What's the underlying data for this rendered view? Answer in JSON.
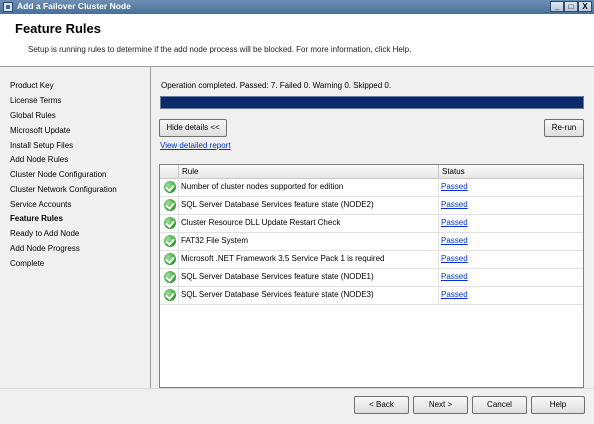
{
  "window": {
    "title": "Add a Failover Cluster Node",
    "buttons": {
      "minimize": "_",
      "maximize": "□",
      "close": "X"
    }
  },
  "header": {
    "title": "Feature Rules",
    "description": "Setup is running rules to determine if the add node process will be blocked. For more information, click Help."
  },
  "nav": {
    "items": [
      {
        "label": "Product Key"
      },
      {
        "label": "License Terms"
      },
      {
        "label": "Global Rules"
      },
      {
        "label": "Microsoft Update"
      },
      {
        "label": "Install Setup Files"
      },
      {
        "label": "Add Node Rules"
      },
      {
        "label": "Cluster Node Configuration"
      },
      {
        "label": "Cluster Network Configuration"
      },
      {
        "label": "Service Accounts"
      },
      {
        "label": "Feature Rules"
      },
      {
        "label": "Ready to Add Node"
      },
      {
        "label": "Add Node Progress"
      },
      {
        "label": "Complete"
      }
    ],
    "active_index": 9
  },
  "content": {
    "summary": "Operation completed. Passed: 7.   Failed 0.   Warning 0.   Skipped 0.",
    "progress_fraction": 1.0,
    "hide_details_label": "Hide details <<",
    "rerun_label": "Re-run",
    "view_report_label": "View detailed report"
  },
  "grid": {
    "columns": {
      "rule": "Rule",
      "status": "Status"
    },
    "rows": [
      {
        "rule": "Number of cluster nodes supported for edition",
        "status": "Passed"
      },
      {
        "rule": "SQL Server Database Services feature state (NODE2)",
        "status": "Passed"
      },
      {
        "rule": "Cluster Resource DLL Update Restart Check",
        "status": "Passed"
      },
      {
        "rule": "FAT32 File System",
        "status": "Passed"
      },
      {
        "rule": "Microsoft .NET Framework 3.5 Service Pack 1 is required",
        "status": "Passed"
      },
      {
        "rule": "SQL Server Database Services feature state (NODE1)",
        "status": "Passed"
      },
      {
        "rule": "SQL Server Database Services feature state (NODE3)",
        "status": "Passed"
      }
    ]
  },
  "footer": {
    "back": "< Back",
    "next": "Next >",
    "cancel": "Cancel",
    "help": "Help"
  },
  "colors": {
    "progress": "#0b2a6b",
    "link": "#0033cc",
    "check": "#2e9a2e"
  },
  "icons": {
    "row_status": "check-circle-icon"
  }
}
